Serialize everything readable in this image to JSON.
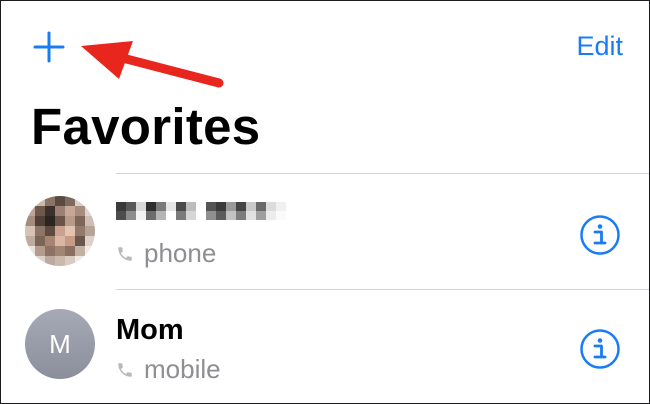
{
  "header": {
    "add_icon": "plus-icon",
    "edit_label": "Edit",
    "title": "Favorites",
    "annotation_arrow_color": "#e8261d"
  },
  "accent_color": "#1a7cf5",
  "favorites": [
    {
      "name": "",
      "name_pixelated": true,
      "subtitle": "phone",
      "avatar": "pixelated-photo",
      "info_icon": "info-icon"
    },
    {
      "name": "Mom",
      "subtitle": "mobile",
      "avatar_initial": "M",
      "info_icon": "info-icon"
    }
  ]
}
